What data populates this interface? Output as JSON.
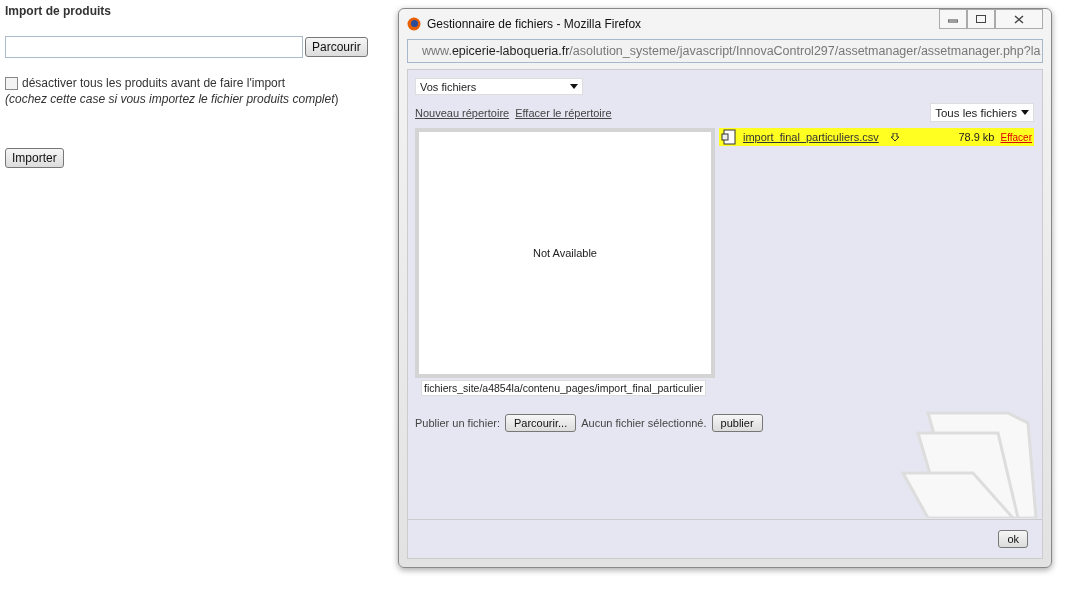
{
  "page": {
    "heading": "Import de produits",
    "file_button": "Parcourir",
    "checkbox": {
      "label": "désactiver tous les produits avant de faire l'import",
      "checked": false
    },
    "note": "*(cochez cette case si vous importez le fichier produits complet*)",
    "submit": "Importer"
  },
  "window": {
    "title": "Gestionnaire de fichiers - Mozilla Firefox",
    "url": {
      "prefix": "www.",
      "domain": "epicerie-laboqueria.fr",
      "path": "/asolution_systeme/javascript/InnovaControl297/assetmanager/assetmanager.php?la"
    }
  },
  "manager": {
    "folder_select": "Vos fichiers",
    "links": [
      "Nouveau répertoire",
      "Effacer le répertoire"
    ],
    "filter_select": "Tous les fichiers",
    "preview_text": "Not Available",
    "path_field": "fichiers_site/a4854la/contenu_pages/import_final_particulier",
    "files": [
      {
        "name": "import_final_particuliers.csv",
        "size": "78.9 kb",
        "delete": "Effacer",
        "selected": true
      }
    ],
    "publish_label": "Publier un fichier:",
    "browse_button": "Parcourir...",
    "no_file": "Aucun fichier sélectionné.",
    "publish_button": "publier",
    "ok_button": "ok"
  }
}
